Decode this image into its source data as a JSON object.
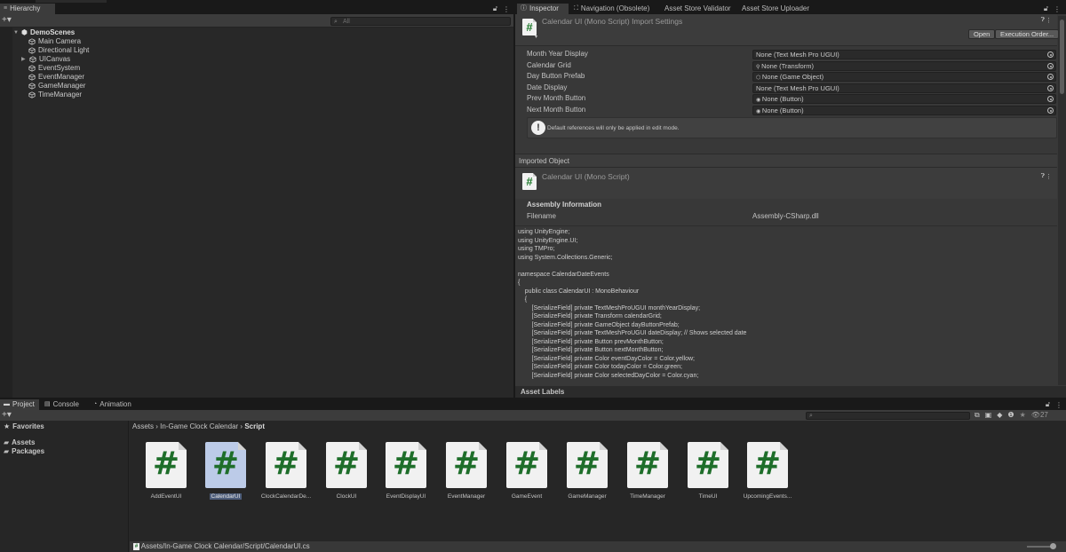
{
  "hierarchy": {
    "tab_label": "Hierarchy",
    "search_placeholder": "All",
    "scene": "DemoScenes",
    "items": [
      "Main Camera",
      "Directional Light",
      "UICanvas",
      "EventSystem",
      "EventManager",
      "GameManager",
      "TimeManager"
    ]
  },
  "inspector": {
    "tabs": [
      "Inspector",
      "Navigation (Obsolete)",
      "Asset Store Validator",
      "Asset Store Uploader"
    ],
    "title": "Calendar UI (Mono Script) Import Settings",
    "open_button": "Open",
    "execution_order_button": "Execution Order...",
    "properties": [
      {
        "label": "Month Year Display",
        "value": "None (Text Mesh Pro UGUI)"
      },
      {
        "label": "Calendar Grid",
        "value": "None (Transform)"
      },
      {
        "label": "Day Button Prefab",
        "value": "None (Game Object)"
      },
      {
        "label": "Date Display",
        "value": "None (Text Mesh Pro UGUI)"
      },
      {
        "label": "Prev Month Button",
        "value": "None (Button)"
      },
      {
        "label": "Next Month Button",
        "value": "None (Button)"
      }
    ],
    "help_text": "Default references will only be applied in edit mode.",
    "imported_object_header": "Imported Object",
    "imported_title": "Calendar UI (Mono Script)",
    "assembly_header": "Assembly Information",
    "filename_label": "Filename",
    "filename_value": "Assembly-CSharp.dll",
    "code_lines": [
      "using UnityEngine;",
      "using UnityEngine.UI;",
      "using TMPro;",
      "using System.Collections.Generic;",
      "",
      "namespace CalendarDateEvents",
      "{",
      "    public class CalendarUI : MonoBehaviour",
      "    {",
      "        [SerializeField] private TextMeshProUGUI monthYearDisplay;",
      "        [SerializeField] private Transform calendarGrid;",
      "        [SerializeField] private GameObject dayButtonPrefab;",
      "        [SerializeField] private TextMeshProUGUI dateDisplay; // Shows selected date",
      "        [SerializeField] private Button prevMonthButton;",
      "        [SerializeField] private Button nextMonthButton;",
      "        [SerializeField] private Color eventDayColor = Color.yellow;",
      "        [SerializeField] private Color todayColor = Color.green;",
      "        [SerializeField] private Color selectedDayColor = Color.cyan;"
    ],
    "asset_labels": "Asset Labels"
  },
  "project": {
    "tabs": [
      "Project",
      "Console",
      "Animation"
    ],
    "favorites": "Favorites",
    "tree": [
      "Assets",
      "Packages"
    ],
    "breadcrumb": [
      "Assets",
      "In-Game Clock  Calendar",
      "Script"
    ],
    "hidden_count": "27",
    "assets": [
      "AddEventUI",
      "CalendarUI",
      "ClockCalendarDe...",
      "ClockUI",
      "EventDisplayUI",
      "EventManager",
      "GameEvent",
      "GameManager",
      "TimeManager",
      "TimeUI",
      "UpcomingEvents..."
    ],
    "selected_asset": "CalendarUI",
    "status_path": "Assets/In-Game Clock  Calendar/Script/CalendarUI.cs"
  },
  "colors": {
    "accent_green": "#1e6e2a",
    "panel": "#282828",
    "inspector_bg": "#383838",
    "selection": "#bccbe8"
  }
}
